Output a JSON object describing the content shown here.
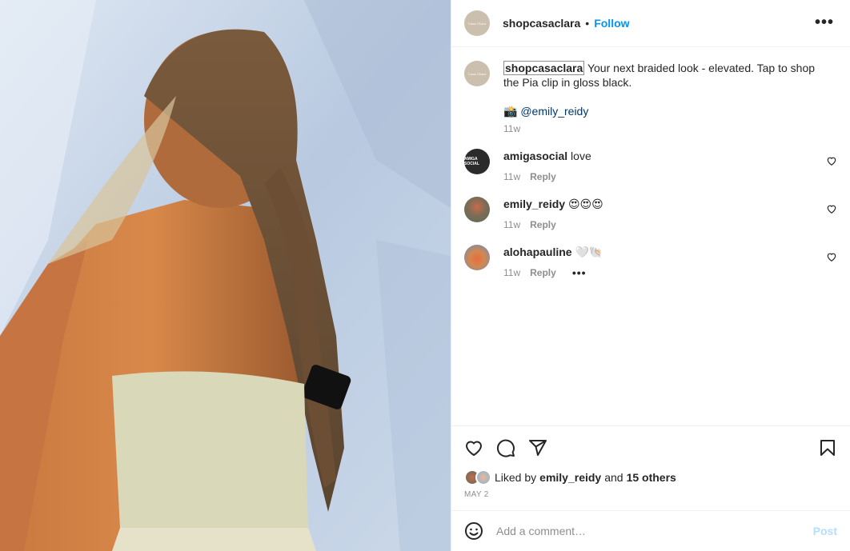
{
  "post": {
    "username": "shopcasaclara",
    "follow_label": "Follow",
    "separator": "•",
    "more_label": "•••",
    "avatar_text": "Casa Clara"
  },
  "caption": {
    "username": "shopcasaclara",
    "text": "Your next braided look - elevated. Tap to shop the Pia clip in gloss black.",
    "credit_emoji": "📸",
    "credit_mention": "@emily_reidy",
    "time": "11w"
  },
  "comments": [
    {
      "username": "amigasocial",
      "text": "love",
      "time": "11w",
      "reply": "Reply",
      "avatar_text": "AMIGA SOCIAL"
    },
    {
      "username": "emily_reidy",
      "text": "😍😍😍",
      "time": "11w",
      "reply": "Reply"
    },
    {
      "username": "alohapauline",
      "text": "🤍🐚",
      "time": "11w",
      "reply": "Reply",
      "more": "•••"
    }
  ],
  "likes": {
    "prefix": "Liked by",
    "user": "emily_reidy",
    "and": "and",
    "others": "15 others",
    "date": "MAY 2"
  },
  "add_comment": {
    "placeholder": "Add a comment…",
    "post_label": "Post"
  },
  "colors": {
    "accent": "#0095f6",
    "post_disabled": "#b2dffc",
    "mention": "#00376b",
    "muted": "#8e8e8e"
  }
}
